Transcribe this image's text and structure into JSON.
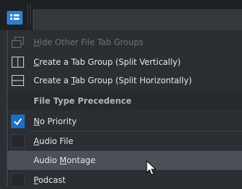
{
  "menu": {
    "items": [
      {
        "label_pre": "",
        "label_u": "H",
        "label_post": "ide Other File Tab Groups",
        "icon": "window-icon",
        "disabled": true
      },
      {
        "label_pre": "",
        "label_u": "C",
        "label_post": "reate a Tab Group (Split Vertically)",
        "icon": "split-vertical-icon"
      },
      {
        "label_pre": "Create a ",
        "label_u": "T",
        "label_post": "ab Group (Split Horizontally)",
        "icon": "split-horizontal-icon"
      }
    ],
    "section_header": "File Type Precedence",
    "options": [
      {
        "label_pre": "",
        "label_u": "N",
        "label_post": "o Priority",
        "checked": true
      },
      {
        "label_pre": "",
        "label_u": "A",
        "label_post": "udio File",
        "checked": false
      },
      {
        "label_pre": "Audio ",
        "label_u": "M",
        "label_post": "ontage",
        "checked": false
      },
      {
        "label_pre": "",
        "label_u": "P",
        "label_post": "odcast",
        "checked": false
      }
    ]
  },
  "colors": {
    "accent": "#2f7fd0",
    "checked": "#1d6fc4",
    "hover": "#4a5057"
  }
}
